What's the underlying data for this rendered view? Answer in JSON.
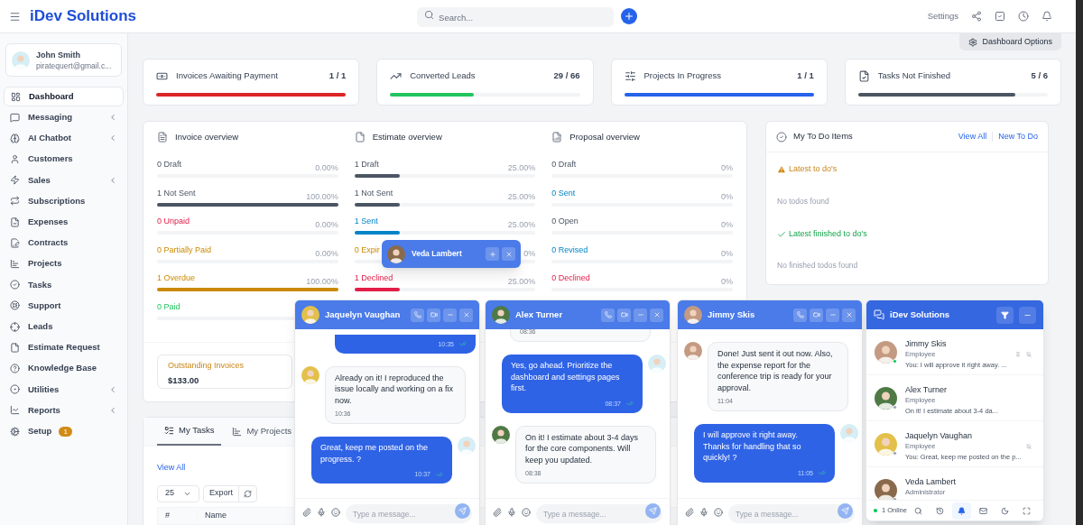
{
  "header": {
    "title": "iDev Solutions",
    "search": {
      "placeholder": "Search..."
    },
    "settings": "Settings"
  },
  "profile": {
    "name": "John Smith",
    "email": "piratequert@gmail.c..."
  },
  "sidebar": {
    "items": [
      {
        "label": "Dashboard",
        "selected": true,
        "expandable": false
      },
      {
        "label": "Messaging",
        "selected": false,
        "expandable": true
      },
      {
        "label": "AI Chatbot",
        "selected": false,
        "expandable": true
      },
      {
        "label": "Customers",
        "selected": false,
        "expandable": false
      },
      {
        "label": "Sales",
        "selected": false,
        "expandable": true
      },
      {
        "label": "Subscriptions",
        "selected": false,
        "expandable": false
      },
      {
        "label": "Expenses",
        "selected": false,
        "expandable": false
      },
      {
        "label": "Contracts",
        "selected": false,
        "expandable": false
      },
      {
        "label": "Projects",
        "selected": false,
        "expandable": false
      },
      {
        "label": "Tasks",
        "selected": false,
        "expandable": false
      },
      {
        "label": "Support",
        "selected": false,
        "expandable": false
      },
      {
        "label": "Leads",
        "selected": false,
        "expandable": false
      },
      {
        "label": "Estimate Request",
        "selected": false,
        "expandable": false
      },
      {
        "label": "Knowledge Base",
        "selected": false,
        "expandable": false
      },
      {
        "label": "Utilities",
        "selected": false,
        "expandable": true
      },
      {
        "label": "Reports",
        "selected": false,
        "expandable": true
      },
      {
        "label": "Setup",
        "selected": false,
        "expandable": false,
        "badge": "1"
      }
    ]
  },
  "dashboard_options": "Dashboard Options",
  "stats": [
    {
      "title": "Invoices Awaiting Payment",
      "value": "1 / 1",
      "level": 1,
      "color": "#dc2626"
    },
    {
      "title": "Converted Leads",
      "value": "29 / 66",
      "level": 0.44,
      "color": "#22c55e"
    },
    {
      "title": "Projects In Progress",
      "value": "1 / 1",
      "level": 1,
      "color": "#2563eb"
    },
    {
      "title": "Tasks Not Finished",
      "value": "5 / 6",
      "level": 0.83,
      "color": "#4b5563"
    }
  ],
  "overview": [
    {
      "title": "Invoice overview",
      "rows": [
        {
          "label": "0 Draft",
          "percent": "0.00%",
          "kind": "neutral"
        },
        {
          "label": "1 Not Sent",
          "percent": "100.00%",
          "level": 1,
          "kind": "neutral"
        },
        {
          "label": "0 Unpaid",
          "percent": "0.00%",
          "kind": "red"
        },
        {
          "label": "0 Partially Paid",
          "percent": "0.00%",
          "kind": "orange"
        },
        {
          "label": "1 Overdue",
          "percent": "100.00%",
          "level": 1,
          "kind": "orange"
        },
        {
          "label": "0 Paid",
          "kind": "green"
        }
      ]
    },
    {
      "title": "Estimate overview",
      "rows": [
        {
          "label": "1 Draft",
          "percent": "25.00%",
          "level": 0.25,
          "kind": "neutral"
        },
        {
          "label": "1 Not Sent",
          "percent": "25.00%",
          "level": 0.25,
          "kind": "neutral"
        },
        {
          "label": "1 Sent",
          "percent": "25.00%",
          "level": 0.25,
          "kind": "blue"
        },
        {
          "label": "0 Expir",
          "percent": "0%",
          "kind": "orange"
        },
        {
          "label": "1 Declined",
          "percent": "25.00%",
          "level": 0.25,
          "kind": "red"
        }
      ]
    },
    {
      "title": "Proposal overview",
      "rows": [
        {
          "label": "0 Draft",
          "percent": "0%",
          "kind": "neutral"
        },
        {
          "label": "0 Sent",
          "percent": "0%",
          "kind": "blue"
        },
        {
          "label": "0 Open",
          "percent": "0%",
          "kind": "neutral"
        },
        {
          "label": "0 Revised",
          "percent": "0%",
          "kind": "blue"
        },
        {
          "label": "0 Declined",
          "percent": "0%",
          "kind": "red"
        }
      ]
    }
  ],
  "outstanding": {
    "label": "Outstanding Invoices",
    "amount": "$133.00"
  },
  "todo": {
    "title": "My To Do Items",
    "links": [
      "View All",
      "New To Do"
    ],
    "latest": "Latest to do's",
    "latest_empty": "No todos found",
    "finished": "Latest finished to do's",
    "finished_empty": "No finished todos found"
  },
  "tasks_panel": {
    "tabs": [
      {
        "label": "My Tasks",
        "selected": true
      },
      {
        "label": "My Projects",
        "selected": false
      }
    ],
    "view_all": "View All",
    "page_size": "25",
    "export": "Export",
    "columns": [
      "#",
      "Name"
    ]
  },
  "minimized_chat": {
    "name": "Veda Lambert"
  },
  "chats": [
    {
      "name": "Jaquelyn Vaughan",
      "placeholder": "Type a message...",
      "messages": [
        {
          "kind": "sent",
          "time": "10:35"
        },
        {
          "kind": "received",
          "text": "Already on it! I reproduced the issue locally and working on a fix now.",
          "time": "10:36"
        },
        {
          "kind": "sent",
          "text": "Great, keep me posted on the progress. ?",
          "time": "10:37"
        }
      ]
    },
    {
      "name": "Alex Turner",
      "placeholder": "Type a message...",
      "messages": [
        {
          "kind": "received",
          "time": "08:36"
        },
        {
          "kind": "sent",
          "text": "Yes, go ahead. Prioritize the dashboard and settings pages first.",
          "time": "08:37"
        },
        {
          "kind": "received",
          "text": "On it! I estimate about 3-4 days for the core components. Will keep you updated.",
          "time": "08:38"
        }
      ]
    },
    {
      "name": "Jimmy Skis",
      "placeholder": "Type a message...",
      "messages": [
        {
          "kind": "received",
          "text": "Done! Just sent it out now. Also, the expense report for the conference trip is ready for your approval.",
          "time": "11:04"
        },
        {
          "kind": "sent",
          "text": "I will approve it right away. Thanks for handling that so quickly! ?",
          "time": "11:05"
        }
      ]
    }
  ],
  "contacts_panel": {
    "title": "iDev Solutions",
    "online": "1 Online",
    "contacts": [
      {
        "name": "Jimmy Skis",
        "role": "Employee",
        "last": "You: I will approve it right away. ...",
        "online": true,
        "pinned": true,
        "muted": true
      },
      {
        "name": "Alex Turner",
        "role": "Employee",
        "last": "On it! I estimate about 3-4 da...",
        "online": false
      },
      {
        "name": "Jaquelyn Vaughan",
        "role": "Employee",
        "last": "You: Great, keep me posted on the p...",
        "online": false,
        "muted": true
      },
      {
        "name": "Veda Lambert",
        "role": "Administrator",
        "online": false
      }
    ],
    "tools": [
      {
        "selected": false
      },
      {
        "selected": false
      },
      {
        "selected": true
      },
      {
        "selected": false
      },
      {
        "selected": false
      },
      {
        "selected": false
      }
    ]
  }
}
